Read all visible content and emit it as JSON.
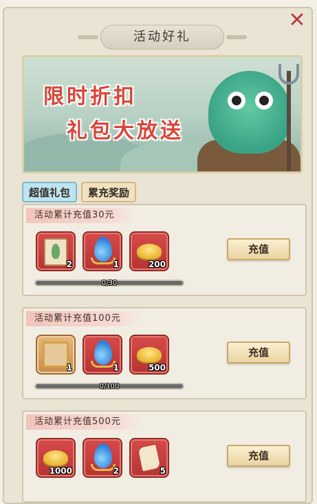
{
  "window": {
    "title": "活动好礼",
    "close_icon": "close-x-icon"
  },
  "banner": {
    "line1": "限时折扣",
    "line2": "礼包大放送"
  },
  "tabs": [
    {
      "label": "超值礼包",
      "active": true
    },
    {
      "label": "累充奖励",
      "active": false
    }
  ],
  "tiers": [
    {
      "title": "活动累计充值30元",
      "button_label": "充值",
      "progress_text": "0/30",
      "progress": 0,
      "rewards": [
        {
          "icon": "seed-scroll-icon",
          "qty": "2"
        },
        {
          "icon": "water-drop-icon",
          "qty": "1"
        },
        {
          "icon": "gold-ingot-icon",
          "qty": "200"
        }
      ]
    },
    {
      "title": "活动累计充值100元",
      "button_label": "充值",
      "progress_text": "0/100",
      "progress": 0,
      "rewards": [
        {
          "icon": "avatar-frame-icon",
          "qty": "1"
        },
        {
          "icon": "water-drop-icon",
          "qty": "1"
        },
        {
          "icon": "gold-ingot-icon",
          "qty": "500"
        }
      ]
    },
    {
      "title": "活动累计充值500元",
      "button_label": "充值",
      "progress_text": "",
      "progress": 0,
      "rewards": [
        {
          "icon": "gold-ingot-icon",
          "qty": "1000"
        },
        {
          "icon": "water-drop-icon",
          "qty": "2"
        },
        {
          "icon": "scroll-icon",
          "qty": "5"
        }
      ]
    }
  ]
}
